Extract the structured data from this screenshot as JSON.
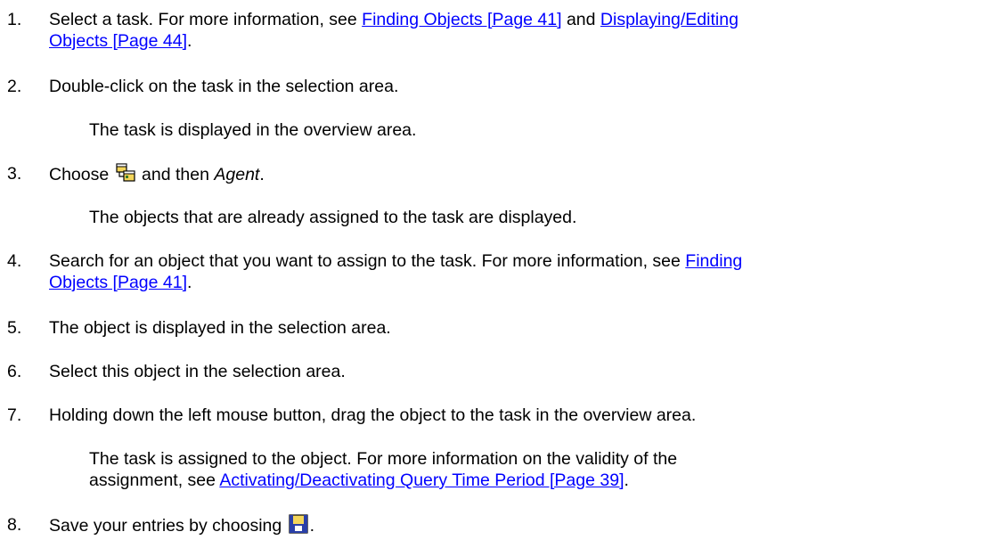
{
  "steps": [
    {
      "num": "1.",
      "t1": "Select a task. For more information, see ",
      "link1": "Finding Objects [Page 41]",
      "t2": " and ",
      "link2a": "Displaying/Editing",
      "link2b": "Objects [Page 44]",
      "t3": "."
    },
    {
      "num": "2.",
      "text": "Double-click on the task in the selection area.",
      "note": "The task is displayed in the overview area."
    },
    {
      "num": "3.",
      "t1": "Choose ",
      "icon": "hierarchy-icon",
      "t2": " and then ",
      "italic": "Agent",
      "t3": ".",
      "note": "The objects that are already assigned to the task are displayed."
    },
    {
      "num": "4.",
      "t1": "Search for an object that you want to assign to the task. For more information, see ",
      "link1a": "Finding",
      "link1b": "Objects [Page 41]",
      "t2": "."
    },
    {
      "num": "5.",
      "text": "The object is displayed in the selection area."
    },
    {
      "num": "6.",
      "text": "Select this object in the selection area."
    },
    {
      "num": "7.",
      "text": "Holding down the left mouse button, drag the object to the task in the overview area.",
      "note_line1": "The task is assigned to the object. For more information on the validity of the",
      "note_line2a": "assignment, see ",
      "note_link": "Activating/Deactivating Query Time Period [Page 39]",
      "note_line2b": "."
    },
    {
      "num": "8.",
      "t1": "Save your entries by choosing ",
      "icon": "save-icon",
      "t2": "."
    }
  ]
}
